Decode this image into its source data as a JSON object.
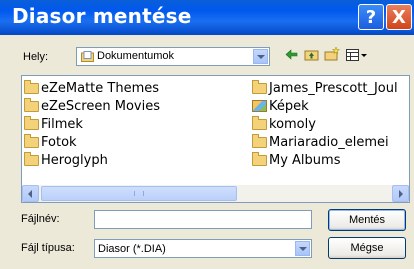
{
  "window": {
    "title": "Diasor mentése",
    "help_label": "?",
    "close_label": "X"
  },
  "location": {
    "label": "Hely:",
    "value": "Dokumentumok"
  },
  "files": {
    "left_column": [
      {
        "name": "eZeMatte Themes",
        "icon": "folder-icon"
      },
      {
        "name": "eZeScreen Movies",
        "icon": "folder-icon"
      },
      {
        "name": "Filmek",
        "icon": "folder-icon"
      },
      {
        "name": "Fotok",
        "icon": "folder-icon"
      },
      {
        "name": "Heroglyph",
        "icon": "folder-icon"
      }
    ],
    "right_column": [
      {
        "name": "James_Prescott_Joul",
        "icon": "folder-icon"
      },
      {
        "name": "Képek",
        "icon": "pictures-folder-icon"
      },
      {
        "name": "komoly",
        "icon": "folder-icon"
      },
      {
        "name": "Mariaradio_elemei",
        "icon": "folder-icon"
      },
      {
        "name": "My Albums",
        "icon": "folder-icon"
      }
    ]
  },
  "filename": {
    "label": "Fájlnév:",
    "value": ""
  },
  "filetype": {
    "label": "Fájl típusa:",
    "value": "Diasor (*.DIA)"
  },
  "buttons": {
    "save": "Mentés",
    "cancel": "Mégse"
  },
  "colors": {
    "titlebar": "#0058EE",
    "dialog_bg": "#ECE9D8",
    "close_button": "#D2441A"
  }
}
